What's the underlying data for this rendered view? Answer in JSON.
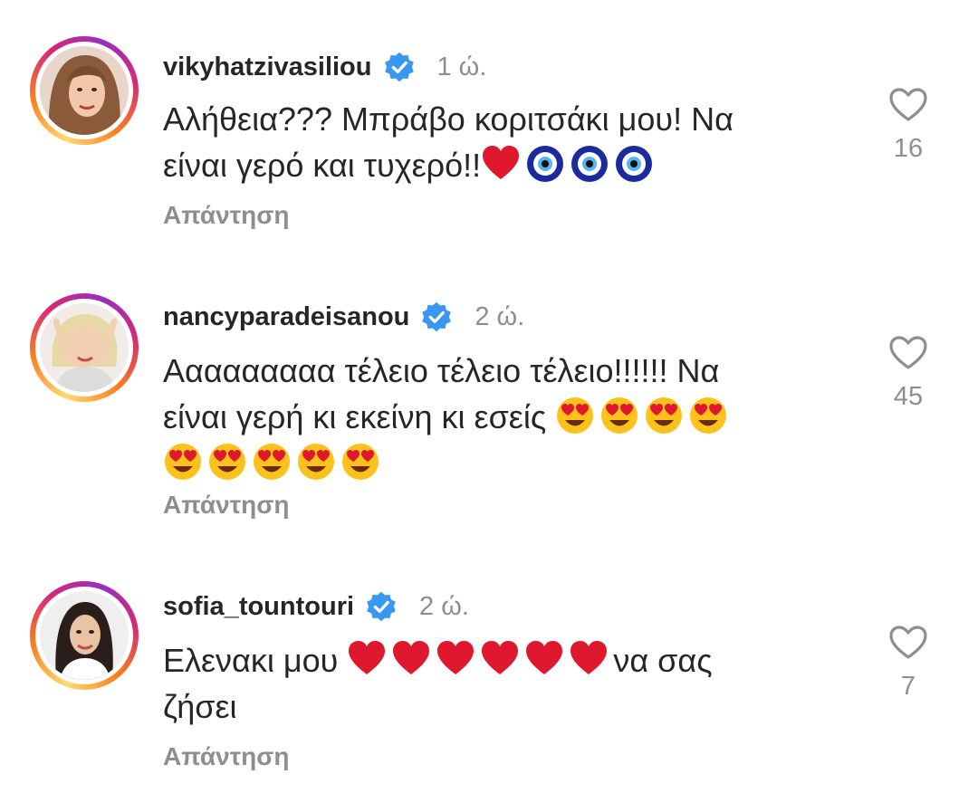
{
  "comments": [
    {
      "username": "vikyhatzivasiliou",
      "time": "1 ώ.",
      "text_line1": "Αλήθεια??? Μπράβο κοριτσάκι μου! Να",
      "text_line2": "είναι γερό και τυχερό!!",
      "emojis": [
        "red-heart",
        "nazar-amulet",
        "nazar-amulet",
        "nazar-amulet"
      ],
      "reply_label": "Απάντηση",
      "likes": "16"
    },
    {
      "username": "nancyparadeisanou",
      "time": "2 ώ.",
      "text_line1": "Ααααααααα τέλειο τέλειο τέλειο!!!!!! Να",
      "text_line2": "είναι γερή κι εκείνη κι εσείς",
      "emojis_line2_count": 4,
      "emojis_line3_count": 5,
      "emoji": "heart-eyes-face",
      "reply_label": "Απάντηση",
      "likes": "45"
    },
    {
      "username": "sofia_tountouri",
      "time": "2 ώ.",
      "text_before": "Ελενακι μου",
      "hearts_count": 6,
      "text_after": "να σας",
      "text_line2": "ζήσει",
      "reply_label": "Απάντηση",
      "likes": "7"
    }
  ],
  "colors": {
    "text": "#262626",
    "secondary": "#8e8e8e",
    "verified": "#3897f0"
  }
}
